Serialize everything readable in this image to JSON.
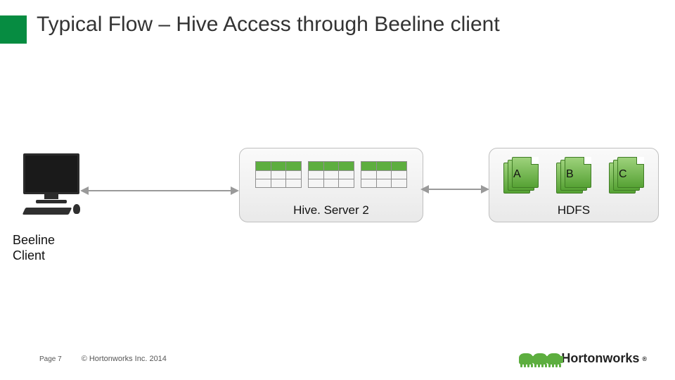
{
  "title": "Typical Flow – Hive Access through Beeline client",
  "client_label_line1": "Beeline",
  "client_label_line2": "Client",
  "hs2_label": "Hive. Server 2",
  "hdfs_label": "HDFS",
  "hdfs_files": {
    "a": "A",
    "b": "B",
    "c": "C"
  },
  "footer": {
    "page": "Page 7",
    "copyright": "© Hortonworks Inc. 2014"
  },
  "logo_text": "Hortonworks",
  "colors": {
    "brand_green": "#5dae3f",
    "accent_green": "#068c41",
    "box_border": "#bfbfbf",
    "arrow": "#9a9a9a"
  }
}
